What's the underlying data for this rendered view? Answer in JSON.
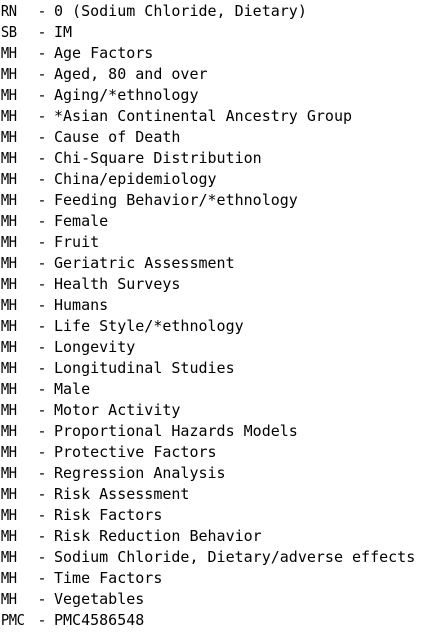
{
  "separator": "-",
  "fields": [
    {
      "tag": "RN",
      "value": "0 (Sodium Chloride, Dietary)"
    },
    {
      "tag": "SB",
      "value": "IM"
    },
    {
      "tag": "MH",
      "value": "Age Factors"
    },
    {
      "tag": "MH",
      "value": "Aged, 80 and over"
    },
    {
      "tag": "MH",
      "value": "Aging/*ethnology"
    },
    {
      "tag": "MH",
      "value": "*Asian Continental Ancestry Group"
    },
    {
      "tag": "MH",
      "value": "Cause of Death"
    },
    {
      "tag": "MH",
      "value": "Chi-Square Distribution"
    },
    {
      "tag": "MH",
      "value": "China/epidemiology"
    },
    {
      "tag": "MH",
      "value": "Feeding Behavior/*ethnology"
    },
    {
      "tag": "MH",
      "value": "Female"
    },
    {
      "tag": "MH",
      "value": "Fruit"
    },
    {
      "tag": "MH",
      "value": "Geriatric Assessment"
    },
    {
      "tag": "MH",
      "value": "Health Surveys"
    },
    {
      "tag": "MH",
      "value": "Humans"
    },
    {
      "tag": "MH",
      "value": "Life Style/*ethnology"
    },
    {
      "tag": "MH",
      "value": "Longevity"
    },
    {
      "tag": "MH",
      "value": "Longitudinal Studies"
    },
    {
      "tag": "MH",
      "value": "Male"
    },
    {
      "tag": "MH",
      "value": "Motor Activity"
    },
    {
      "tag": "MH",
      "value": "Proportional Hazards Models"
    },
    {
      "tag": "MH",
      "value": "Protective Factors"
    },
    {
      "tag": "MH",
      "value": "Regression Analysis"
    },
    {
      "tag": "MH",
      "value": "Risk Assessment"
    },
    {
      "tag": "MH",
      "value": "Risk Factors"
    },
    {
      "tag": "MH",
      "value": "Risk Reduction Behavior"
    },
    {
      "tag": "MH",
      "value": "Sodium Chloride, Dietary/adverse effects"
    },
    {
      "tag": "MH",
      "value": "Time Factors"
    },
    {
      "tag": "MH",
      "value": "Vegetables"
    },
    {
      "tag": "PMC",
      "value": "PMC4586548"
    }
  ]
}
